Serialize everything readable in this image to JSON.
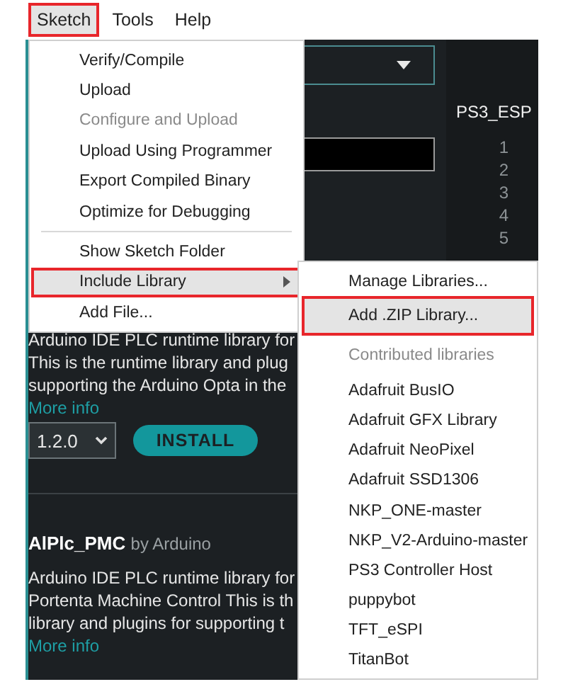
{
  "menubar": [
    {
      "label": "Sketch",
      "selected": true
    },
    {
      "label": "Tools",
      "selected": false
    },
    {
      "label": "Help",
      "selected": false
    }
  ],
  "sketch_menu": [
    {
      "kind": "item",
      "label": "Verify/Compile",
      "disabled": false,
      "selected": false,
      "has_submenu": false
    },
    {
      "kind": "item",
      "label": "Upload",
      "disabled": false,
      "selected": false,
      "has_submenu": false
    },
    {
      "kind": "item",
      "label": "Configure and Upload",
      "disabled": true,
      "selected": false,
      "has_submenu": false
    },
    {
      "kind": "item",
      "label": "Upload Using Programmer",
      "disabled": false,
      "selected": false,
      "has_submenu": false
    },
    {
      "kind": "item",
      "label": "Export Compiled Binary",
      "disabled": false,
      "selected": false,
      "has_submenu": false
    },
    {
      "kind": "item",
      "label": "Optimize for Debugging",
      "disabled": false,
      "selected": false,
      "has_submenu": false
    },
    {
      "kind": "separator"
    },
    {
      "kind": "item",
      "label": "Show Sketch Folder",
      "disabled": false,
      "selected": false,
      "has_submenu": false
    },
    {
      "kind": "item",
      "label": "Include Library",
      "disabled": false,
      "selected": true,
      "has_submenu": true
    },
    {
      "kind": "item",
      "label": "Add File...",
      "disabled": false,
      "selected": false,
      "has_submenu": false
    }
  ],
  "library_submenu": [
    {
      "kind": "item",
      "label": "Manage Libraries...",
      "selected": false
    },
    {
      "kind": "item",
      "label": "Add .ZIP Library...",
      "selected": true
    },
    {
      "kind": "header",
      "label": "Contributed libraries"
    },
    {
      "kind": "item",
      "label": "Adafruit BusIO",
      "selected": false
    },
    {
      "kind": "item",
      "label": "Adafruit GFX Library",
      "selected": false
    },
    {
      "kind": "item",
      "label": "Adafruit NeoPixel",
      "selected": false
    },
    {
      "kind": "item",
      "label": "Adafruit SSD1306",
      "selected": false
    },
    {
      "kind": "item",
      "label": "NKP_ONE-master",
      "selected": false
    },
    {
      "kind": "item",
      "label": "NKP_V2-Arduino-master",
      "selected": false
    },
    {
      "kind": "item",
      "label": "PS3 Controller Host",
      "selected": false
    },
    {
      "kind": "item",
      "label": "puppybot",
      "selected": false
    },
    {
      "kind": "item",
      "label": "TFT_eSPI",
      "selected": false
    },
    {
      "kind": "item",
      "label": "TitanBot",
      "selected": false
    }
  ],
  "editor": {
    "tab": "PS3_ESP",
    "line_numbers": [
      "1",
      "2",
      "3",
      "4",
      "5"
    ]
  },
  "libraries": [
    {
      "description": [
        "Arduino IDE PLC runtime library for",
        "This is the runtime library and plug",
        "supporting the Arduino Opta in the"
      ],
      "more_info": "More info",
      "version": "1.2.0",
      "install": "INSTALL"
    },
    {
      "title": "AlPlc_PMC",
      "author": "by Arduino",
      "description": [
        "Arduino IDE PLC runtime library for",
        "Portenta Machine Control This is th",
        "library and plugins for supporting t"
      ],
      "more_info": "More info"
    }
  ]
}
